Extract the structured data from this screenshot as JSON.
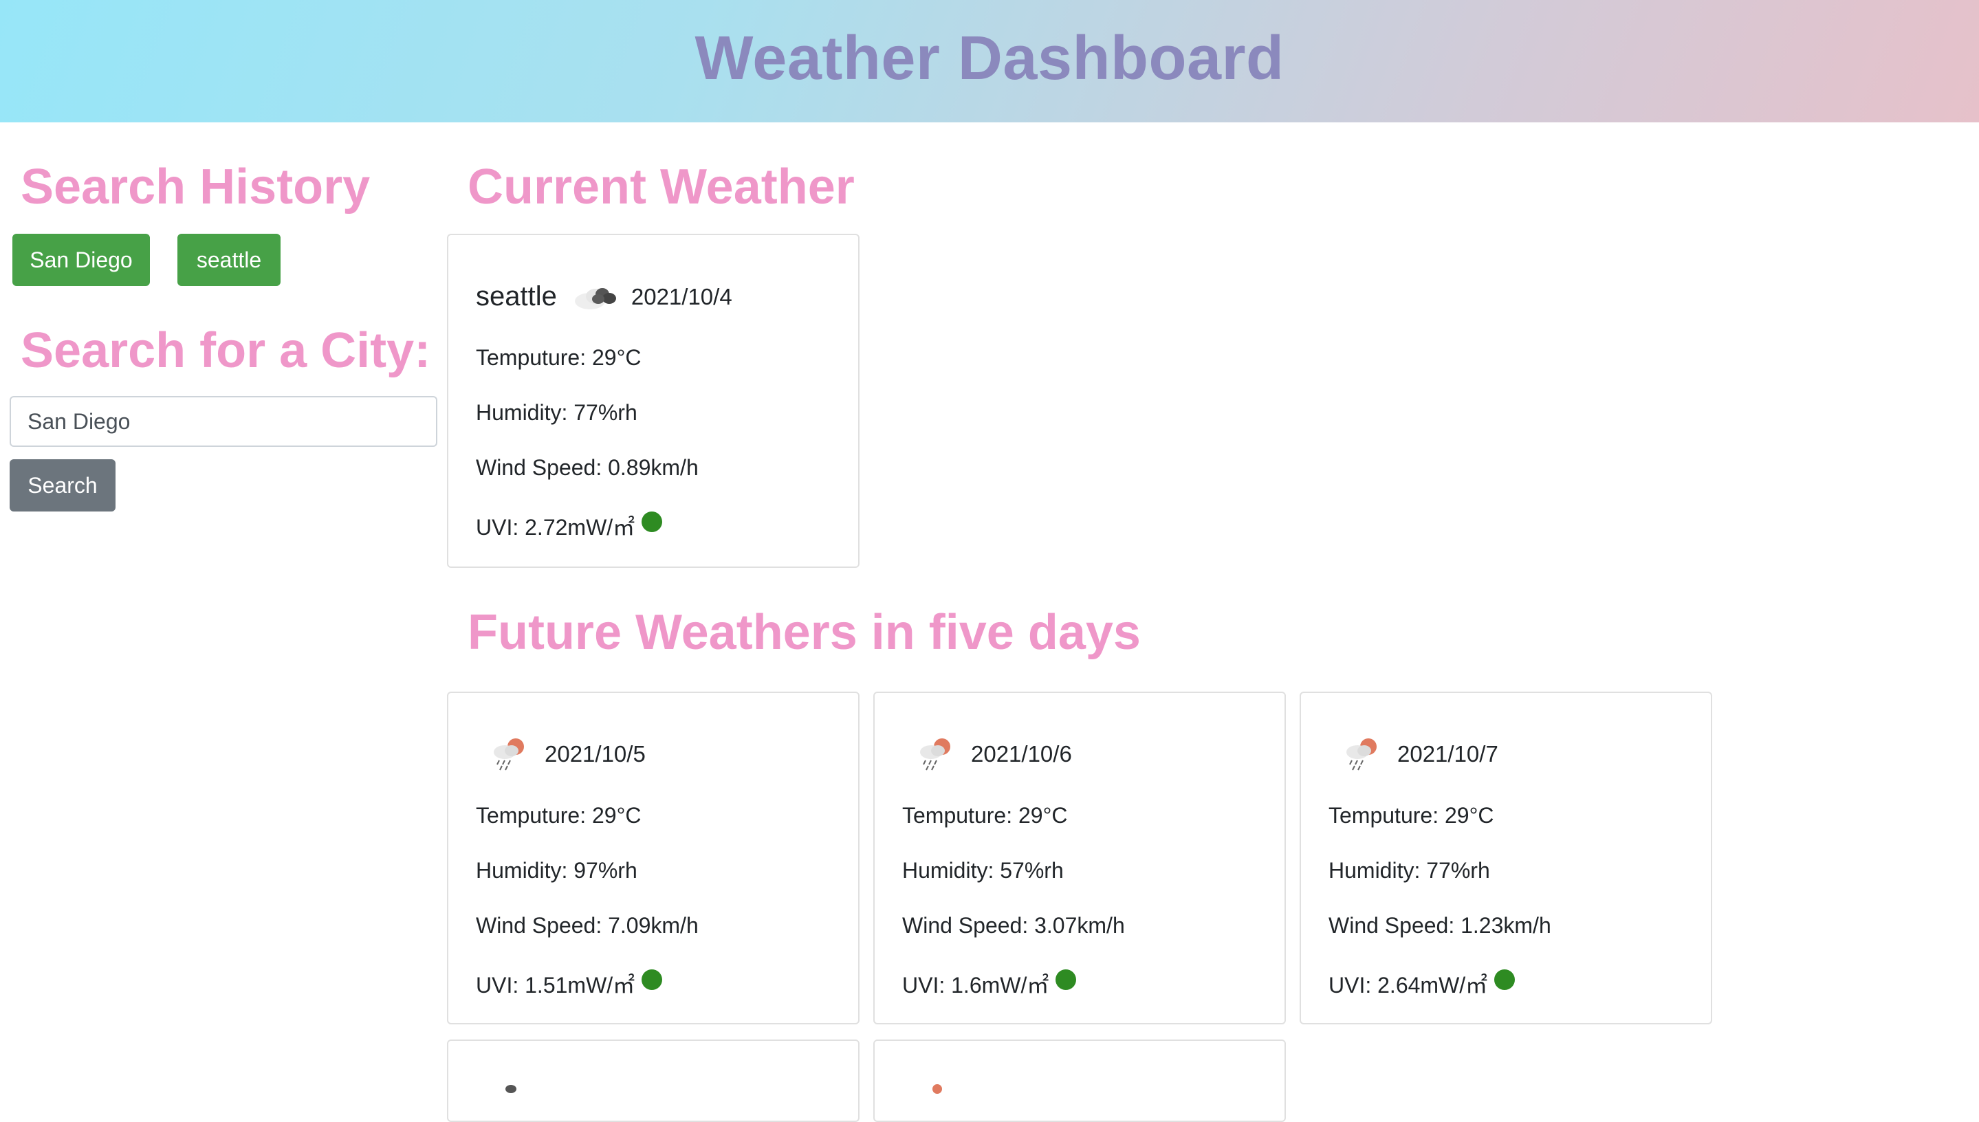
{
  "app": {
    "title": "Weather Dashboard"
  },
  "history": {
    "heading": "Search History",
    "items": [
      {
        "label": "San Diego"
      },
      {
        "label": "seattle"
      }
    ]
  },
  "search": {
    "heading": "Search for a City:",
    "value": "San Diego",
    "button_label": "Search"
  },
  "current": {
    "heading": "Current Weather",
    "city": "seattle",
    "icon": "cloudy-icon",
    "date": "2021/10/4",
    "temp": "Temputure: 29°C",
    "humidity": "Humidity: 77%rh",
    "wind": "Wind Speed: 0.89km/h",
    "uvi": "UVI: 2.72mW/㎡",
    "uvi_color": "#2e8b22"
  },
  "forecast": {
    "heading": "Future Weathers in five days",
    "days": [
      {
        "date": "2021/10/5",
        "icon": "rain-sun-icon",
        "temp": "Temputure: 29°C",
        "humidity": "Humidity: 97%rh",
        "wind": "Wind Speed: 7.09km/h",
        "uvi": "UVI: 1.51mW/㎡"
      },
      {
        "date": "2021/10/6",
        "icon": "rain-sun-icon",
        "temp": "Temputure: 29°C",
        "humidity": "Humidity: 57%rh",
        "wind": "Wind Speed: 3.07km/h",
        "uvi": "UVI: 1.6mW/㎡"
      },
      {
        "date": "2021/10/7",
        "icon": "rain-sun-icon",
        "temp": "Temputure: 29°C",
        "humidity": "Humidity: 77%rh",
        "wind": "Wind Speed: 1.23km/h",
        "uvi": "UVI: 2.64mW/㎡"
      }
    ]
  },
  "colors": {
    "accent_heading": "#ef97c9",
    "title": "#8b89bd",
    "history_button": "#47a147",
    "search_button": "#6c757d",
    "uvi_good": "#2e8b22"
  }
}
